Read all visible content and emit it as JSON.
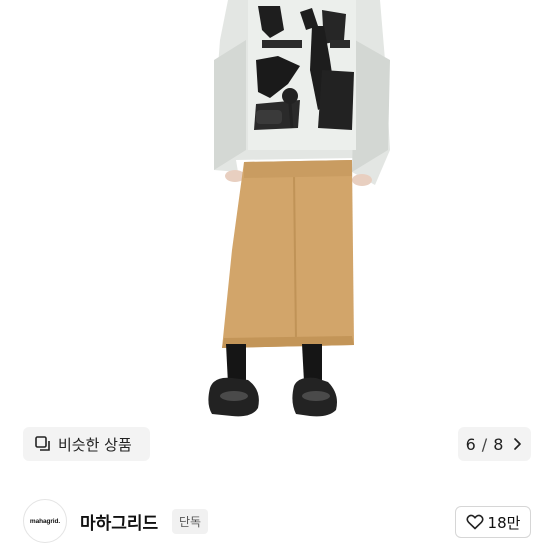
{
  "gallery": {
    "similar_label": "비슷한 상품",
    "current_page": "6",
    "total_pages": "8",
    "page_separator": "/"
  },
  "brand": {
    "logo_text": "mahagrid.",
    "name": "마하그리드",
    "badge": "단독"
  },
  "like": {
    "count": "18만"
  },
  "icons": {
    "similar": "similar-products-icon",
    "chevron": "chevron-right-icon",
    "heart": "heart-outline-icon"
  }
}
